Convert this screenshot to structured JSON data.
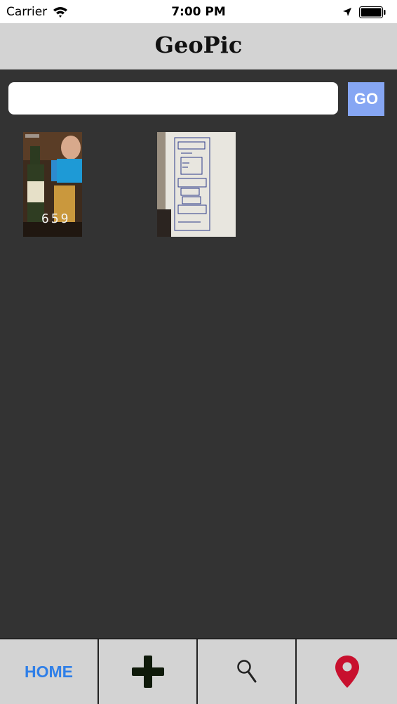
{
  "status_bar": {
    "carrier": "Carrier",
    "time": "7:00 PM"
  },
  "header": {
    "title": "GeoPic"
  },
  "search": {
    "value": "",
    "placeholder": "",
    "go_label": "GO"
  },
  "gallery": {
    "photo_1_counter": "659"
  },
  "tabbar": {
    "home_label": "HOME",
    "icons": [
      "plus-icon",
      "search-icon",
      "map-pin-icon"
    ]
  },
  "colors": {
    "background": "#333333",
    "header": "#d3d3d3",
    "go_button": "#86a6f3",
    "home_label": "#2f7fe8",
    "map_pin": "#c8102e"
  }
}
